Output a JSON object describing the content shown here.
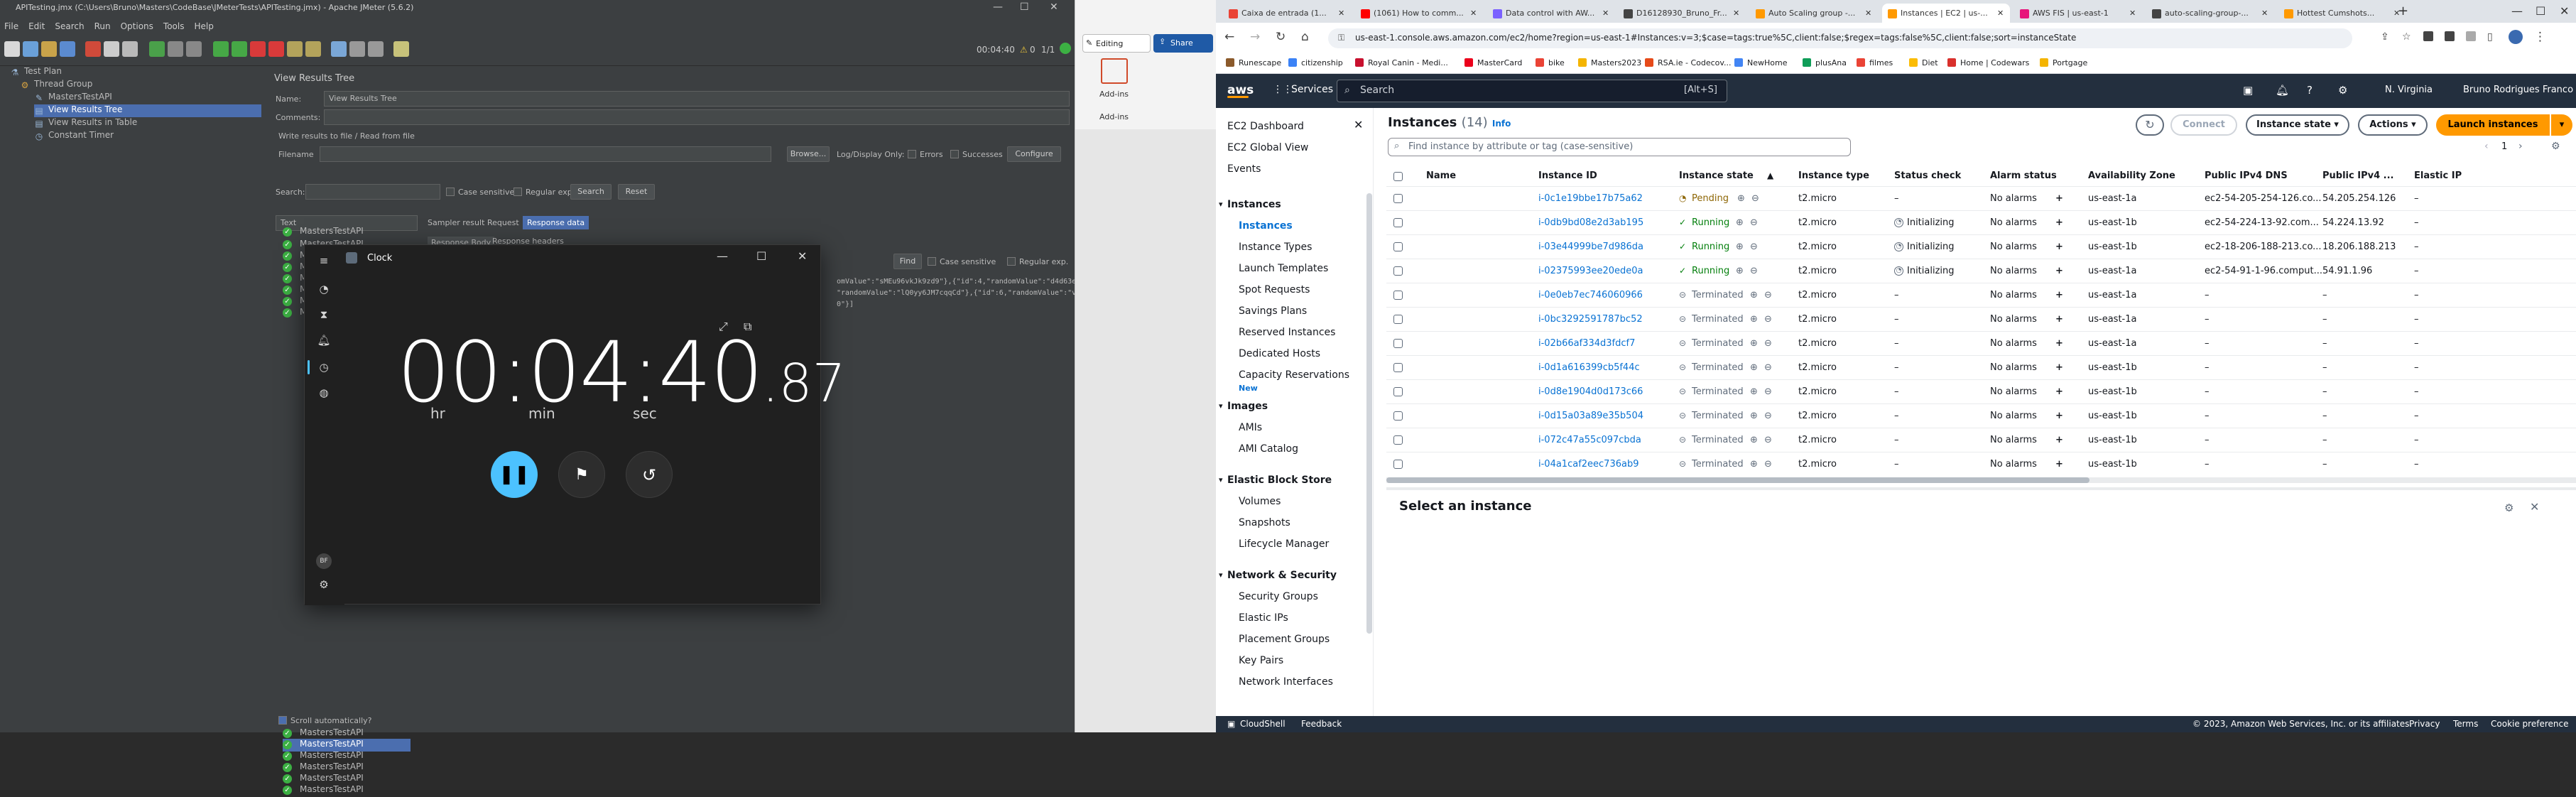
{
  "jmeter": {
    "title": "APITesting.jmx (C:\\Users\\Bruno\\Masters\\CodeBase\\JMeterTests\\APITesting.jmx) - Apache JMeter (5.6.2)",
    "menu": [
      "File",
      "Edit",
      "Search",
      "Run",
      "Options",
      "Tools",
      "Help"
    ],
    "timer": "00:04:40",
    "warn_count": "0",
    "ratio": "1/1",
    "tree": [
      {
        "label": "Test Plan",
        "icon": "flask-icon"
      },
      {
        "label": "Thread Group",
        "icon": "gear-icon"
      },
      {
        "label": "MastersTestAPI",
        "icon": "pipette-icon"
      },
      {
        "label": "View Results Tree",
        "icon": "chart-icon"
      },
      {
        "label": "View Results in Table",
        "icon": "chart-icon"
      },
      {
        "label": "Constant Timer",
        "icon": "clock-icon"
      }
    ],
    "panel": {
      "heading": "View Results Tree",
      "name_label": "Name:",
      "name_value": "View Results Tree",
      "comments_label": "Comments:",
      "write_all": "Write results to file / Read from file",
      "filename_label": "Filename",
      "browse": "Browse...",
      "log_only": "Log/Display Only:",
      "errors": "Errors",
      "successes": "Successes",
      "configure": "Configure",
      "search_label": "Search:",
      "case_sensitive": "Case sensitive",
      "regular_exp": "Regular exp.",
      "search_btn": "Search",
      "reset_btn": "Reset",
      "renderer": "Text",
      "tab_sampler": "Sampler result",
      "tab_request": "Request",
      "tab_response": "Response data",
      "sub_body": "Response Body",
      "sub_headers": "Response headers",
      "find_btn": "Find",
      "response_snippet_1": "omValue\":\"sMEu96vkJk9zd9\"},{\"id\":4,\"randomValue\":\"d4d63e3ed",
      "response_snippet_2": "\"randomValue\":\"lQ0yy6JM7cqqCd\"},{\"id\":6,\"randomValue\":\"v",
      "response_snippet_3": "0\"}]",
      "result_item": "MastersTestAPI",
      "scroll_auto": "Scroll automatically?"
    }
  },
  "clock": {
    "title": "Clock",
    "time_main": "00:04:40",
    "time_cs": ".87",
    "unit_hr": "hr",
    "unit_min": "min",
    "unit_sec": "sec",
    "rail_badge": "BF"
  },
  "word": {
    "editing": "Editing",
    "share": "Share",
    "addins": "Add-ins",
    "addins2": "Add-ins"
  },
  "chrome": {
    "tabs": [
      {
        "label": "Caixa de entrada (1...",
        "color": "#ea4335"
      },
      {
        "label": "(1061) How to comm...",
        "color": "#ff0000"
      },
      {
        "label": "Data control with AW...",
        "color": "#7b61ff"
      },
      {
        "label": "D16128930_Bruno_Fr...",
        "color": "#444"
      },
      {
        "label": "Auto Scaling group -...",
        "color": "#ff9900"
      },
      {
        "label": "Instances | EC2 | us-...",
        "color": "#ff9900"
      },
      {
        "label": "AWS FIS | us-east-1",
        "color": "#e7157b"
      },
      {
        "label": "auto-scaling-group-...",
        "color": "#444"
      },
      {
        "label": "Hottest Cumshots...",
        "color": "#f90"
      }
    ],
    "url": "us-east-1.console.aws.amazon.com/ec2/home?region=us-east-1#Instances:v=3;$case=tags:true%5C,client:false;$regex=tags:false%5C,client:false;sort=instanceState",
    "bookmarks": [
      "Runescape",
      "citizenship",
      "Royal Canin - Medi...",
      "MasterCard",
      "bike",
      "Masters2023",
      "RSA.ie - Codecov...",
      "NewHome",
      "plusAna",
      "filmes",
      "Diet",
      "Home | Codewars",
      "Portgage"
    ]
  },
  "aws": {
    "services": "Services",
    "search_placeholder": "Search",
    "search_shortcut": "[Alt+S]",
    "region": "N. Virginia",
    "account": "Bruno Rodrigues Franco",
    "side": {
      "top": [
        "EC2 Dashboard",
        "EC2 Global View",
        "Events"
      ],
      "instances_h": "Instances",
      "instances": [
        "Instances",
        "Instance Types",
        "Launch Templates",
        "Spot Requests",
        "Savings Plans",
        "Reserved Instances",
        "Dedicated Hosts",
        "Capacity Reservations"
      ],
      "new_badge": "New",
      "images_h": "Images",
      "images": [
        "AMIs",
        "AMI Catalog"
      ],
      "ebs_h": "Elastic Block Store",
      "ebs": [
        "Volumes",
        "Snapshots",
        "Lifecycle Manager"
      ],
      "net_h": "Network & Security",
      "net": [
        "Security Groups",
        "Elastic IPs",
        "Placement Groups",
        "Key Pairs",
        "Network Interfaces"
      ]
    },
    "main": {
      "title": "Instances",
      "count": "(14)",
      "info": "Info",
      "filter_placeholder": "Find instance by attribute or tag (case-sensitive)",
      "connect": "Connect",
      "instance_state": "Instance state",
      "actions": "Actions",
      "launch": "Launch instances",
      "page": "1",
      "columns": [
        "Name",
        "Instance ID",
        "Instance state",
        "Instance type",
        "Status check",
        "Alarm status",
        "Availability Zone",
        "Public IPv4 DNS",
        "Public IPv4 ...",
        "Elastic IP"
      ],
      "rows": [
        {
          "id": "i-0c1e19bbe17b75a62",
          "state": "Pending",
          "type": "t2.micro",
          "check": "–",
          "alarm": "No alarms",
          "az": "us-east-1a",
          "dns": "ec2-54-205-254-126.co...",
          "ip": "54.205.254.126",
          "eip": "–"
        },
        {
          "id": "i-0db9bd08e2d3ab195",
          "state": "Running",
          "type": "t2.micro",
          "check": "Initializing",
          "alarm": "No alarms",
          "az": "us-east-1b",
          "dns": "ec2-54-224-13-92.com...",
          "ip": "54.224.13.92",
          "eip": "–"
        },
        {
          "id": "i-03e44999be7d986da",
          "state": "Running",
          "type": "t2.micro",
          "check": "Initializing",
          "alarm": "No alarms",
          "az": "us-east-1b",
          "dns": "ec2-18-206-188-213.co...",
          "ip": "18.206.188.213",
          "eip": "–"
        },
        {
          "id": "i-02375993ee20ede0a",
          "state": "Running",
          "type": "t2.micro",
          "check": "Initializing",
          "alarm": "No alarms",
          "az": "us-east-1a",
          "dns": "ec2-54-91-1-96.comput...",
          "ip": "54.91.1.96",
          "eip": "–"
        },
        {
          "id": "i-0e0eb7ec746060966",
          "state": "Terminated",
          "type": "t2.micro",
          "check": "–",
          "alarm": "No alarms",
          "az": "us-east-1a",
          "dns": "–",
          "ip": "–",
          "eip": "–"
        },
        {
          "id": "i-0bc3292591787bc52",
          "state": "Terminated",
          "type": "t2.micro",
          "check": "–",
          "alarm": "No alarms",
          "az": "us-east-1a",
          "dns": "–",
          "ip": "–",
          "eip": "–"
        },
        {
          "id": "i-02b66af334d3fdcf7",
          "state": "Terminated",
          "type": "t2.micro",
          "check": "–",
          "alarm": "No alarms",
          "az": "us-east-1a",
          "dns": "–",
          "ip": "–",
          "eip": "–"
        },
        {
          "id": "i-0d1a616399cb5f44c",
          "state": "Terminated",
          "type": "t2.micro",
          "check": "–",
          "alarm": "No alarms",
          "az": "us-east-1b",
          "dns": "–",
          "ip": "–",
          "eip": "–"
        },
        {
          "id": "i-0d8e1904d0d173c66",
          "state": "Terminated",
          "type": "t2.micro",
          "check": "–",
          "alarm": "No alarms",
          "az": "us-east-1b",
          "dns": "–",
          "ip": "–",
          "eip": "–"
        },
        {
          "id": "i-0d15a03a89e35b504",
          "state": "Terminated",
          "type": "t2.micro",
          "check": "–",
          "alarm": "No alarms",
          "az": "us-east-1b",
          "dns": "–",
          "ip": "–",
          "eip": "–"
        },
        {
          "id": "i-072c47a55c097cbda",
          "state": "Terminated",
          "type": "t2.micro",
          "check": "–",
          "alarm": "No alarms",
          "az": "us-east-1b",
          "dns": "–",
          "ip": "–",
          "eip": "–"
        },
        {
          "id": "i-04a1caf2eec736ab9",
          "state": "Terminated",
          "type": "t2.micro",
          "check": "–",
          "alarm": "No alarms",
          "az": "us-east-1b",
          "dns": "–",
          "ip": "–",
          "eip": "–"
        }
      ],
      "select_instance": "Select an instance"
    },
    "footer": {
      "cloudshell": "CloudShell",
      "feedback": "Feedback",
      "copyright": "© 2023, Amazon Web Services, Inc. or its affiliates.",
      "privacy": "Privacy",
      "terms": "Terms",
      "cookies": "Cookie preference"
    },
    "colors": {
      "pending": "#8d6605",
      "running": "#037f0c",
      "terminated": "#5f6b7a",
      "link": "#0972d3",
      "orange": "#ff9900"
    }
  }
}
